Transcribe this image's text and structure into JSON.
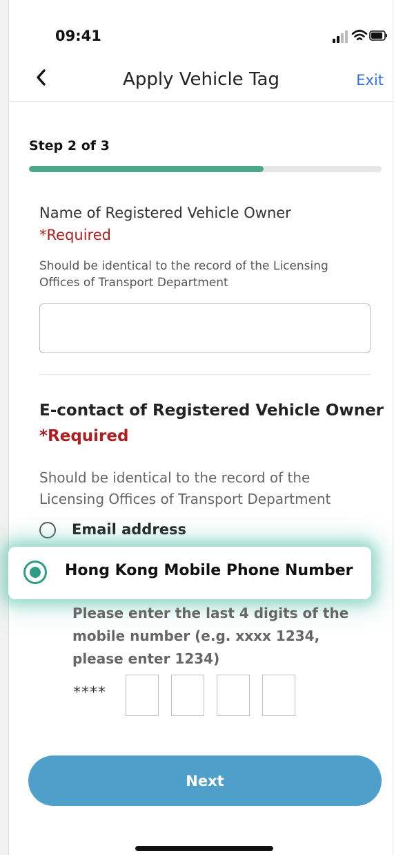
{
  "status_bar": {
    "time": "09:41"
  },
  "nav": {
    "title": "Apply Vehicle Tag",
    "exit_label": "Exit"
  },
  "progress": {
    "label": "Step 2 of 3",
    "fraction": 0.665
  },
  "owner_name": {
    "label": "Name of Registered Vehicle Owner",
    "required": "*Required",
    "help": "Should be identical to the record of the Licensing Offices of Transport Department",
    "value": ""
  },
  "econtact": {
    "label": "E-contact of Registered Vehicle Owner",
    "required": "*Required",
    "help": "Should be identical to the record of the Licensing Offices of Transport Department",
    "options": [
      {
        "label": "Email address",
        "selected": false
      },
      {
        "label": "Hong Kong Mobile Phone Number",
        "selected": true
      }
    ],
    "mobile_help": "Please enter the last 4 digits of the mobile number (e.g. xxxx 1234, please enter 1234)",
    "mask": "****",
    "digits": [
      "",
      "",
      "",
      ""
    ]
  },
  "next_label": "Next",
  "colors": {
    "accent": "#4ca889",
    "button": "#4f9fcb",
    "required": "#b01f1f",
    "link": "#2f6fdc"
  }
}
